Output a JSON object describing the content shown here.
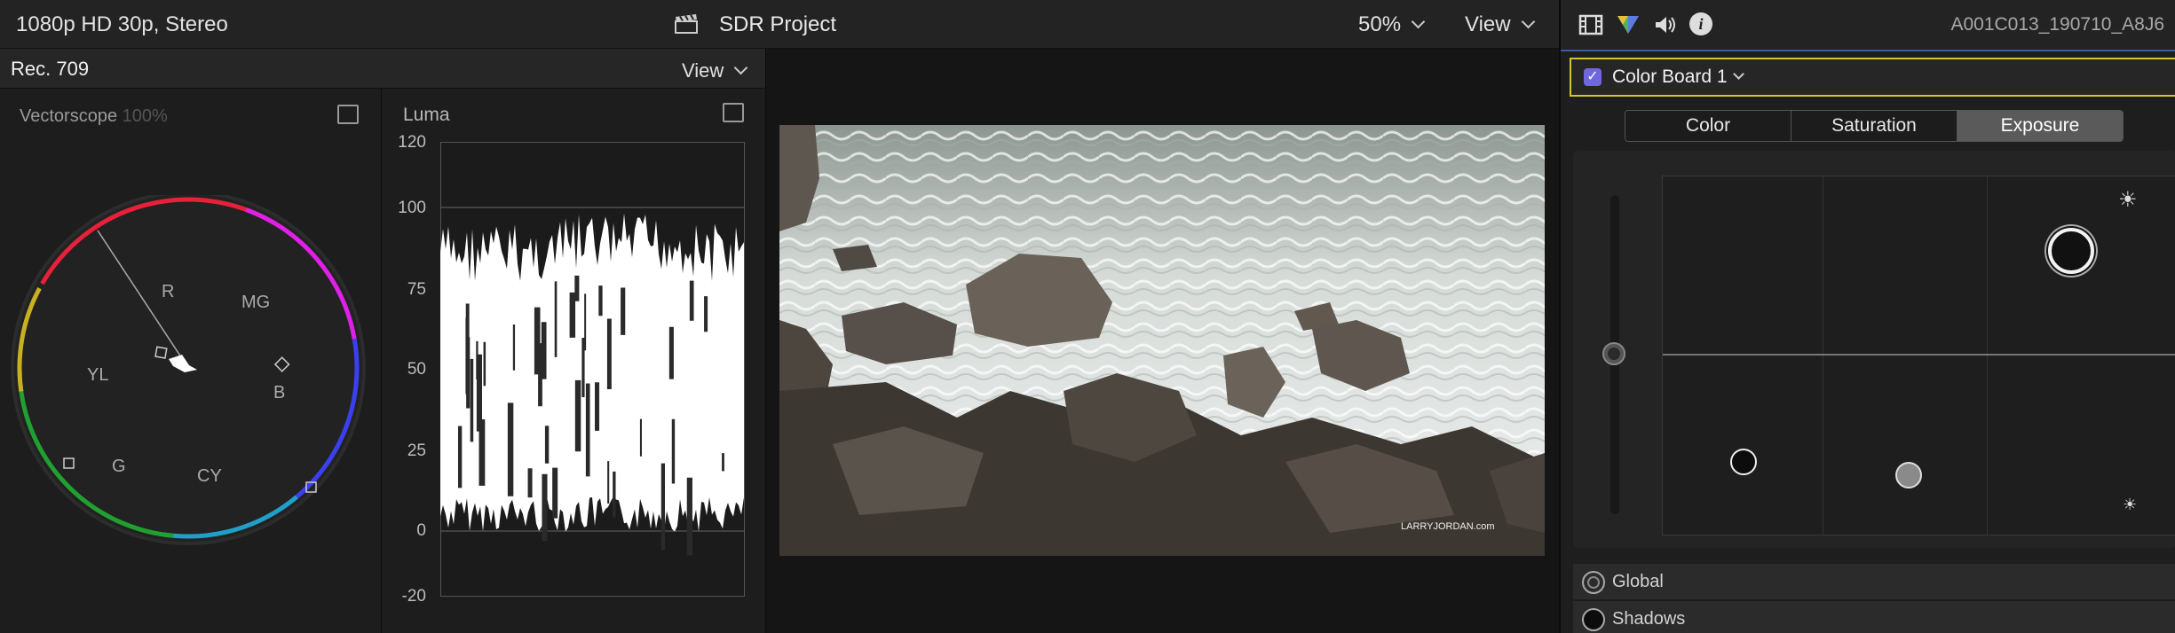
{
  "topbar": {
    "format": "1080p HD 30p, Stereo",
    "project": "SDR Project",
    "zoom": "50%",
    "view": "View"
  },
  "scopes": {
    "header": {
      "standard": "Rec. 709",
      "view": "View"
    },
    "vectorscope": {
      "title": "Vectorscope",
      "percent": "100%",
      "targets": [
        "R",
        "MG",
        "YL",
        "B",
        "G",
        "CY"
      ]
    },
    "luma": {
      "title": "Luma",
      "y_ticks": [
        "120",
        "100",
        "75",
        "50",
        "25",
        "0",
        "-20"
      ]
    }
  },
  "viewer": {
    "watermark": "LARRYJORDAN.com"
  },
  "inspector": {
    "clip_name": "A001C013_190710_A8J6",
    "effect": {
      "label": "Color Board 1",
      "enabled": true
    },
    "tabs": [
      "Color",
      "Saturation",
      "Exposure"
    ],
    "active_tab": "Exposure",
    "rows": [
      "Global",
      "Shadows"
    ]
  },
  "colors": {
    "accent_border": "#d4c42e",
    "checkbox": "#6f67e0",
    "inspector_line": "#3a5fa0"
  }
}
